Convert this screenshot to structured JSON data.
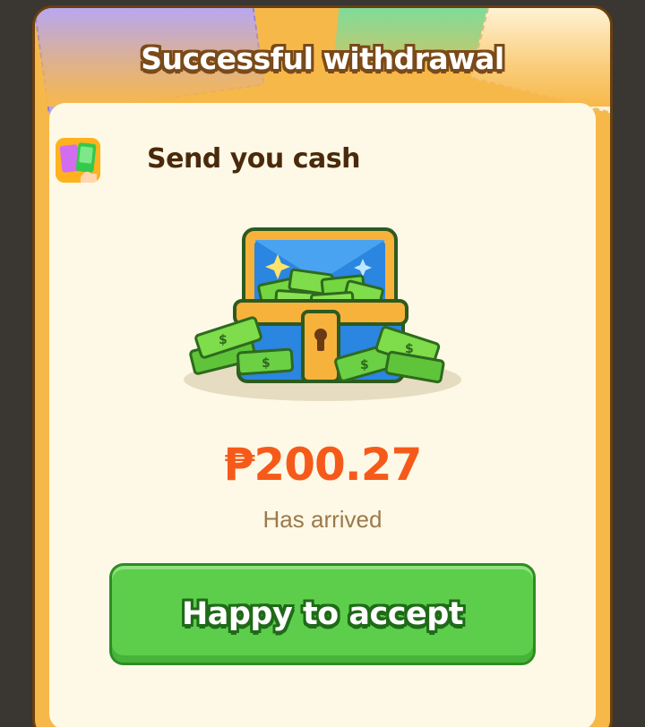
{
  "dialog": {
    "title": "Successful withdrawal"
  },
  "sender": {
    "icon": "wallet-cards-app-icon",
    "text": "Send you cash"
  },
  "illustration": {
    "icon": "treasure-chest-cash-icon"
  },
  "reward": {
    "amount": "₱200.27",
    "status": "Has arrived"
  },
  "actions": {
    "accept_label": "Happy to accept"
  },
  "colors": {
    "frame": "#f7b84a",
    "card": "#fef9e6",
    "amount": "#f65a1a",
    "button": "#5cce4c"
  }
}
